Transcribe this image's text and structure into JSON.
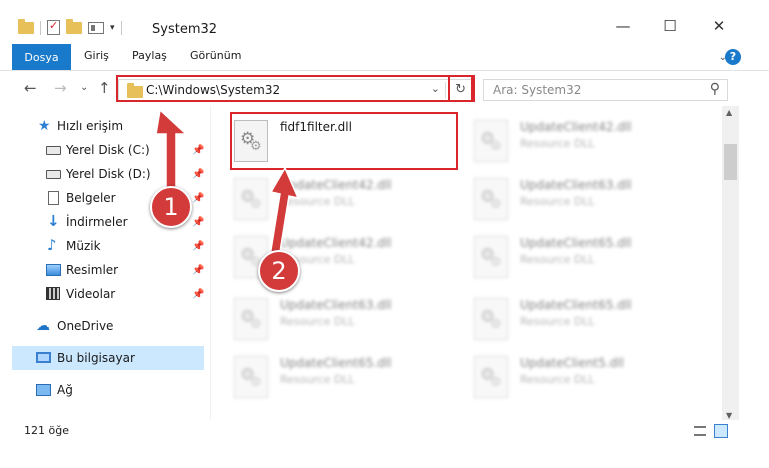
{
  "window": {
    "title": "System32",
    "minimize": "—",
    "maximize": "☐",
    "close": "✕"
  },
  "ribbon": {
    "tabs": [
      "Dosya",
      "Giriş",
      "Paylaş",
      "Görünüm"
    ],
    "expand": "⌄",
    "help": "?"
  },
  "nav": {
    "back": "←",
    "forward": "→",
    "recent": "⌄",
    "up": "↑",
    "address": "C:\\Windows\\System32",
    "address_dropdown": "⌄",
    "refresh": "↻",
    "search_placeholder": "Ara: System32",
    "search_icon": "⚲"
  },
  "sidebar": {
    "items": [
      {
        "label": "Hızlı erişim",
        "icon": "star-icon",
        "pinned": false
      },
      {
        "label": "Yerel Disk (C:)",
        "icon": "drive-icon",
        "pinned": true
      },
      {
        "label": "Yerel Disk (D:)",
        "icon": "drive-icon",
        "pinned": true
      },
      {
        "label": "Belgeler",
        "icon": "document-icon",
        "pinned": true
      },
      {
        "label": "İndirmeler",
        "icon": "download-icon",
        "pinned": true
      },
      {
        "label": "Müzik",
        "icon": "music-icon",
        "pinned": true
      },
      {
        "label": "Resimler",
        "icon": "pictures-icon",
        "pinned": true
      },
      {
        "label": "Videolar",
        "icon": "video-icon",
        "pinned": true
      },
      {
        "label": "OneDrive",
        "icon": "cloud-icon",
        "pinned": false
      },
      {
        "label": "Bu bilgisayar",
        "icon": "computer-icon",
        "pinned": false,
        "selected": true
      },
      {
        "label": "Ağ",
        "icon": "network-icon",
        "pinned": false
      }
    ],
    "pin_glyph": "📌"
  },
  "files": [
    {
      "name": "fidf1filter.dll",
      "type": "",
      "highlighted": true
    },
    {
      "name": "UpdateClient42.dll",
      "type": "Resource DLL"
    },
    {
      "name": "UpdateClient42.dll",
      "type": "Resource DLL"
    },
    {
      "name": "UpdateClient63.dll",
      "type": "Resource DLL"
    },
    {
      "name": "UpdateClient42.dll",
      "type": "Resource DLL"
    },
    {
      "name": "UpdateClient65.dll",
      "type": "Resource DLL"
    },
    {
      "name": "UpdateClient63.dll",
      "type": "Resource DLL"
    },
    {
      "name": "UpdateClient65.dll",
      "type": "Resource DLL"
    },
    {
      "name": "UpdateClient65.dll",
      "type": "Resource DLL"
    },
    {
      "name": "UpdateClient5.dll",
      "type": "Resource DLL"
    }
  ],
  "status": {
    "count": "121 öğe"
  },
  "annotations": {
    "badge1": "1",
    "badge2": "2",
    "color": "#d9262c"
  },
  "colors": {
    "accent": "#1979ca",
    "selection": "#cce8ff",
    "folder": "#e8c05a"
  }
}
